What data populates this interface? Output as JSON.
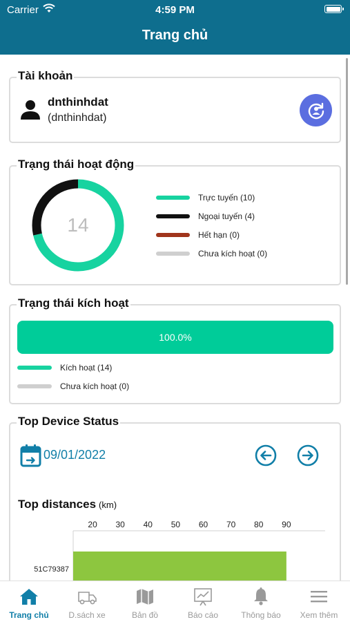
{
  "status_bar": {
    "carrier": "Carrier",
    "time": "4:59 PM"
  },
  "header": {
    "title": "Trang chủ"
  },
  "account": {
    "title": "Tài khoản",
    "username": "dnthinhdat",
    "subname": "(dnthinhdat)"
  },
  "activity": {
    "title": "Trạng thái hoạt động",
    "total": "14",
    "legend": [
      {
        "label": "Trực tuyến (10)",
        "color": "#17d3a0",
        "value": 10
      },
      {
        "label": "Ngoại tuyến (4)",
        "color": "#111111",
        "value": 4
      },
      {
        "label": "Hết hạn (0)",
        "color": "#a0351c",
        "value": 0
      },
      {
        "label": "Chưa kích hoạt (0)",
        "color": "#cfcfcf",
        "value": 0
      }
    ]
  },
  "activation": {
    "title": "Trạng thái kích hoạt",
    "bar_label": "100.0%",
    "bar_color": "#00cc99",
    "legend": [
      {
        "label": "Kích hoạt (14)",
        "color": "#17d3a0"
      },
      {
        "label": "Chưa kích hoạt (0)",
        "color": "#cfcfcf"
      }
    ]
  },
  "top_device": {
    "title": "Top Device Status",
    "date": "09/01/2022",
    "distances_title": "Top distances",
    "distances_unit": "(km)"
  },
  "chart_data": {
    "type": "bar",
    "orientation": "horizontal",
    "title": "Top distances",
    "xlabel": "(km)",
    "ylabel": "",
    "x_ticks": [
      20,
      30,
      40,
      50,
      60,
      70,
      80,
      90
    ],
    "xlim": [
      13,
      104
    ],
    "categories": [
      "51C79387"
    ],
    "values": [
      90
    ],
    "bar_color": "#8dc63f",
    "grid": false
  },
  "tabs": [
    {
      "label": "Trang chủ",
      "icon": "home-icon",
      "active": true
    },
    {
      "label": "D.sách xe",
      "icon": "truck-icon",
      "active": false
    },
    {
      "label": "Bản đồ",
      "icon": "map-icon",
      "active": false
    },
    {
      "label": "Báo cáo",
      "icon": "report-chart-icon",
      "active": false
    },
    {
      "label": "Thông báo",
      "icon": "bell-icon",
      "active": false
    },
    {
      "label": "Xem thêm",
      "icon": "menu-icon",
      "active": false
    }
  ],
  "colors": {
    "header_bg": "#0e6e8e",
    "accent": "#117fa8",
    "green": "#00cc99",
    "refresh_button": "#5b6ee0"
  }
}
